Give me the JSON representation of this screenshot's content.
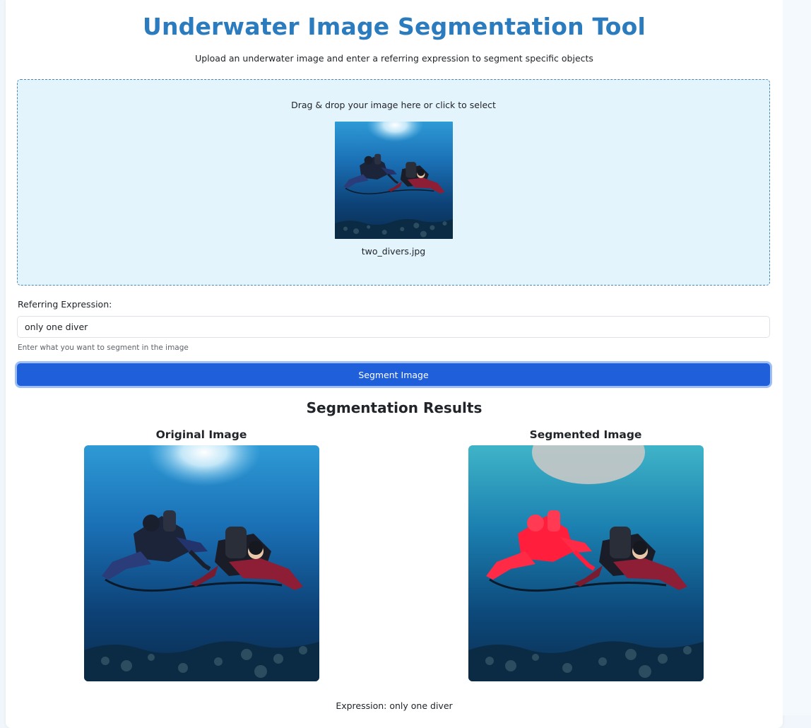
{
  "app": {
    "title": "Underwater Image Segmentation Tool",
    "subtitle": "Upload an underwater image and enter a referring expression to segment specific objects"
  },
  "upload": {
    "prompt": "Drag & drop your image here or click to select",
    "filename": "two_divers.jpg"
  },
  "form": {
    "label": "Referring Expression:",
    "value": "only one diver",
    "help": "Enter what you want to segment in the image",
    "submit_label": "Segment Image"
  },
  "results": {
    "title": "Segmentation Results",
    "original_title": "Original Image",
    "segmented_title": "Segmented Image",
    "expression_label": "Expression: only one diver"
  },
  "colors": {
    "accent": "#2b7bbf",
    "button": "#1f5fd9",
    "dropzone_bg": "#e4f4fc",
    "mask": "#ff1e3c"
  }
}
